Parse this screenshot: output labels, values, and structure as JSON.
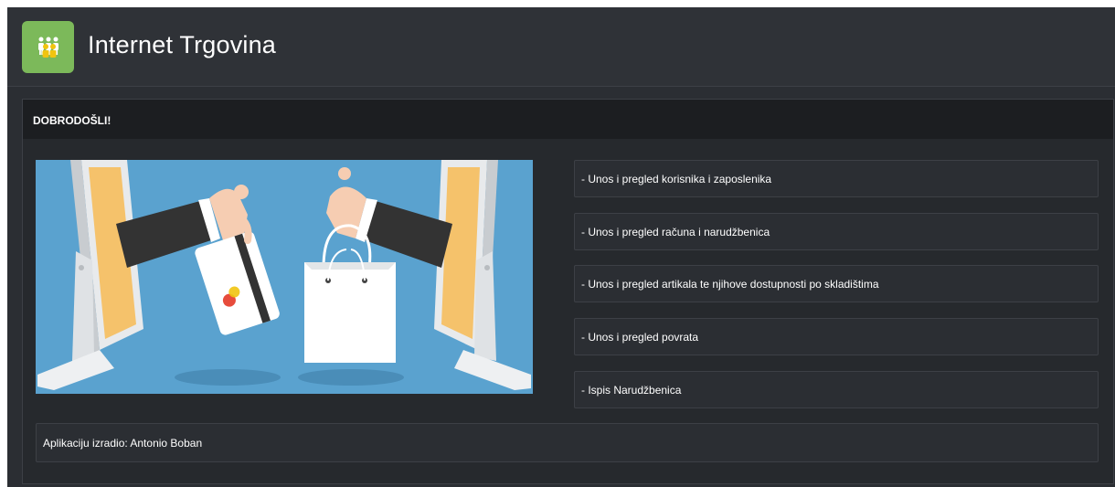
{
  "header": {
    "title": "Internet Trgovina",
    "logo_icon": "users-group-icon",
    "logo_color": "#7cb95a"
  },
  "panel": {
    "title": "DOBRODOŠLI!",
    "illustration_icon": "online-shopping-illustration",
    "nav_items": [
      {
        "label": "- Unos i pregled korisnika i zaposlenika"
      },
      {
        "label": "- Unos i pregled računa i narudžbenica"
      },
      {
        "label": "- Unos i pregled artikala te njihove dostupnosti po skladištima"
      },
      {
        "label": "- Unos i pregled povrata"
      },
      {
        "label": "- Ispis Narudžbenica"
      }
    ],
    "footer": "Aplikaciju izradio: Antonio Boban"
  }
}
